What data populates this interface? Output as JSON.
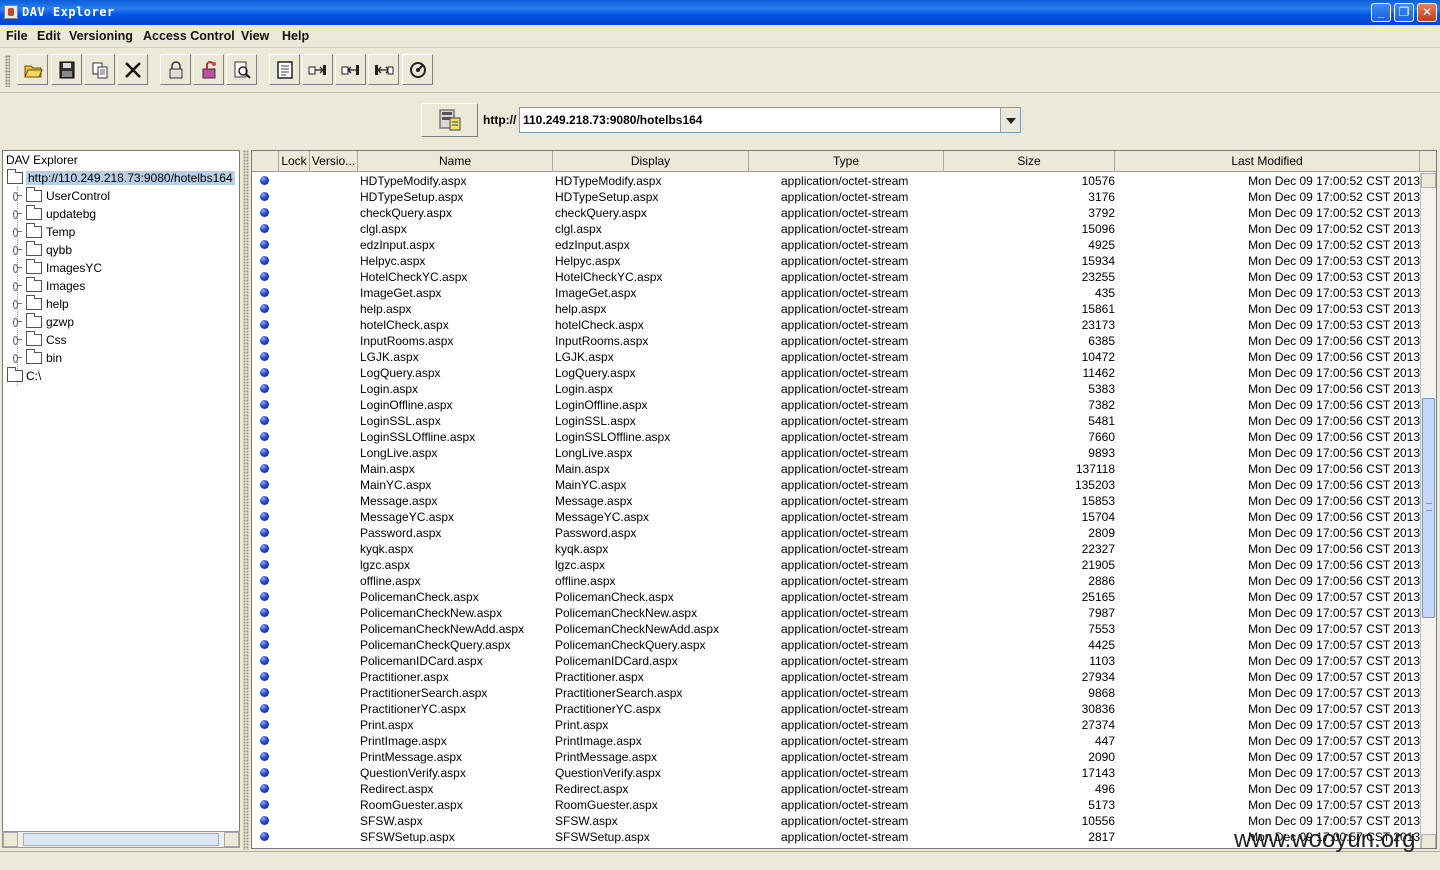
{
  "window": {
    "title": "DAV Explorer"
  },
  "menu": [
    "File",
    "Edit",
    "Versioning",
    "Access Control",
    "View",
    "Help"
  ],
  "toolbar": {
    "buttons": [
      "open-folder",
      "save",
      "copy",
      "cut",
      "lock",
      "unlock",
      "properties",
      "new-file",
      "put",
      "get",
      "move",
      "refresh"
    ]
  },
  "address": {
    "prefix": "http://",
    "value": "110.249.218.73:9080/hotelbs164"
  },
  "tree": {
    "root": "DAV Explorer",
    "server": "http://110.249.218.73:9080/hotelbs164",
    "folders": [
      "UserControl",
      "updatebg",
      "Temp",
      "qybb",
      "ImagesYC",
      "Images",
      "help",
      "gzwp",
      "Css",
      "bin"
    ],
    "drive": "C:\\"
  },
  "table": {
    "columns": [
      "Lock",
      "Versio...",
      "Name",
      "Display",
      "Type",
      "Size",
      "Last Modified"
    ],
    "rows": [
      [
        "HDTypeModify.aspx",
        "HDTypeModify.aspx",
        "application/octet-stream",
        "10576",
        "Mon Dec 09 17:00:52 CST 2013"
      ],
      [
        "HDTypeSetup.aspx",
        "HDTypeSetup.aspx",
        "application/octet-stream",
        "3176",
        "Mon Dec 09 17:00:52 CST 2013"
      ],
      [
        "checkQuery.aspx",
        "checkQuery.aspx",
        "application/octet-stream",
        "3792",
        "Mon Dec 09 17:00:52 CST 2013"
      ],
      [
        "clgl.aspx",
        "clgl.aspx",
        "application/octet-stream",
        "15096",
        "Mon Dec 09 17:00:52 CST 2013"
      ],
      [
        "edzInput.aspx",
        "edzInput.aspx",
        "application/octet-stream",
        "4925",
        "Mon Dec 09 17:00:52 CST 2013"
      ],
      [
        "Helpyc.aspx",
        "Helpyc.aspx",
        "application/octet-stream",
        "15934",
        "Mon Dec 09 17:00:53 CST 2013"
      ],
      [
        "HotelCheckYC.aspx",
        "HotelCheckYC.aspx",
        "application/octet-stream",
        "23255",
        "Mon Dec 09 17:00:53 CST 2013"
      ],
      [
        "ImageGet.aspx",
        "ImageGet.aspx",
        "application/octet-stream",
        "435",
        "Mon Dec 09 17:00:53 CST 2013"
      ],
      [
        "help.aspx",
        "help.aspx",
        "application/octet-stream",
        "15861",
        "Mon Dec 09 17:00:53 CST 2013"
      ],
      [
        "hotelCheck.aspx",
        "hotelCheck.aspx",
        "application/octet-stream",
        "23173",
        "Mon Dec 09 17:00:53 CST 2013"
      ],
      [
        "InputRooms.aspx",
        "InputRooms.aspx",
        "application/octet-stream",
        "6385",
        "Mon Dec 09 17:00:56 CST 2013"
      ],
      [
        "LGJK.aspx",
        "LGJK.aspx",
        "application/octet-stream",
        "10472",
        "Mon Dec 09 17:00:56 CST 2013"
      ],
      [
        "LogQuery.aspx",
        "LogQuery.aspx",
        "application/octet-stream",
        "11462",
        "Mon Dec 09 17:00:56 CST 2013"
      ],
      [
        "Login.aspx",
        "Login.aspx",
        "application/octet-stream",
        "5383",
        "Mon Dec 09 17:00:56 CST 2013"
      ],
      [
        "LoginOffline.aspx",
        "LoginOffline.aspx",
        "application/octet-stream",
        "7382",
        "Mon Dec 09 17:00:56 CST 2013"
      ],
      [
        "LoginSSL.aspx",
        "LoginSSL.aspx",
        "application/octet-stream",
        "5481",
        "Mon Dec 09 17:00:56 CST 2013"
      ],
      [
        "LoginSSLOffline.aspx",
        "LoginSSLOffline.aspx",
        "application/octet-stream",
        "7660",
        "Mon Dec 09 17:00:56 CST 2013"
      ],
      [
        "LongLive.aspx",
        "LongLive.aspx",
        "application/octet-stream",
        "9893",
        "Mon Dec 09 17:00:56 CST 2013"
      ],
      [
        "Main.aspx",
        "Main.aspx",
        "application/octet-stream",
        "137118",
        "Mon Dec 09 17:00:56 CST 2013"
      ],
      [
        "MainYC.aspx",
        "MainYC.aspx",
        "application/octet-stream",
        "135203",
        "Mon Dec 09 17:00:56 CST 2013"
      ],
      [
        "Message.aspx",
        "Message.aspx",
        "application/octet-stream",
        "15853",
        "Mon Dec 09 17:00:56 CST 2013"
      ],
      [
        "MessageYC.aspx",
        "MessageYC.aspx",
        "application/octet-stream",
        "15704",
        "Mon Dec 09 17:00:56 CST 2013"
      ],
      [
        "Password.aspx",
        "Password.aspx",
        "application/octet-stream",
        "2809",
        "Mon Dec 09 17:00:56 CST 2013"
      ],
      [
        "kyqk.aspx",
        "kyqk.aspx",
        "application/octet-stream",
        "22327",
        "Mon Dec 09 17:00:56 CST 2013"
      ],
      [
        "lgzc.aspx",
        "lgzc.aspx",
        "application/octet-stream",
        "21905",
        "Mon Dec 09 17:00:56 CST 2013"
      ],
      [
        "offline.aspx",
        "offline.aspx",
        "application/octet-stream",
        "2886",
        "Mon Dec 09 17:00:56 CST 2013"
      ],
      [
        "PolicemanCheck.aspx",
        "PolicemanCheck.aspx",
        "application/octet-stream",
        "25165",
        "Mon Dec 09 17:00:57 CST 2013"
      ],
      [
        "PolicemanCheckNew.aspx",
        "PolicemanCheckNew.aspx",
        "application/octet-stream",
        "7987",
        "Mon Dec 09 17:00:57 CST 2013"
      ],
      [
        "PolicemanCheckNewAdd.aspx",
        "PolicemanCheckNewAdd.aspx",
        "application/octet-stream",
        "7553",
        "Mon Dec 09 17:00:57 CST 2013"
      ],
      [
        "PolicemanCheckQuery.aspx",
        "PolicemanCheckQuery.aspx",
        "application/octet-stream",
        "4425",
        "Mon Dec 09 17:00:57 CST 2013"
      ],
      [
        "PolicemanIDCard.aspx",
        "PolicemanIDCard.aspx",
        "application/octet-stream",
        "1103",
        "Mon Dec 09 17:00:57 CST 2013"
      ],
      [
        "Practitioner.aspx",
        "Practitioner.aspx",
        "application/octet-stream",
        "27934",
        "Mon Dec 09 17:00:57 CST 2013"
      ],
      [
        "PractitionerSearch.aspx",
        "PractitionerSearch.aspx",
        "application/octet-stream",
        "9868",
        "Mon Dec 09 17:00:57 CST 2013"
      ],
      [
        "PractitionerYC.aspx",
        "PractitionerYC.aspx",
        "application/octet-stream",
        "30836",
        "Mon Dec 09 17:00:57 CST 2013"
      ],
      [
        "Print.aspx",
        "Print.aspx",
        "application/octet-stream",
        "27374",
        "Mon Dec 09 17:00:57 CST 2013"
      ],
      [
        "PrintImage.aspx",
        "PrintImage.aspx",
        "application/octet-stream",
        "447",
        "Mon Dec 09 17:00:57 CST 2013"
      ],
      [
        "PrintMessage.aspx",
        "PrintMessage.aspx",
        "application/octet-stream",
        "2090",
        "Mon Dec 09 17:00:57 CST 2013"
      ],
      [
        "QuestionVerify.aspx",
        "QuestionVerify.aspx",
        "application/octet-stream",
        "17143",
        "Mon Dec 09 17:00:57 CST 2013"
      ],
      [
        "Redirect.aspx",
        "Redirect.aspx",
        "application/octet-stream",
        "496",
        "Mon Dec 09 17:00:57 CST 2013"
      ],
      [
        "RoomGuester.aspx",
        "RoomGuester.aspx",
        "application/octet-stream",
        "5173",
        "Mon Dec 09 17:00:57 CST 2013"
      ],
      [
        "SFSW.aspx",
        "SFSW.aspx",
        "application/octet-stream",
        "10556",
        "Mon Dec 09 17:00:57 CST 2013"
      ],
      [
        "SFSWSetup.aspx",
        "SFSWSetup.aspx",
        "application/octet-stream",
        "2817",
        "Mon Dec 09 17:00:57 CST 2013"
      ]
    ]
  },
  "watermark": "www.wooyun.org",
  "colors": {
    "titlebar": "#0054e3",
    "window_bg": "#ece9d8",
    "selection": "#b8cfe5",
    "status_dot": "#2745c8"
  }
}
